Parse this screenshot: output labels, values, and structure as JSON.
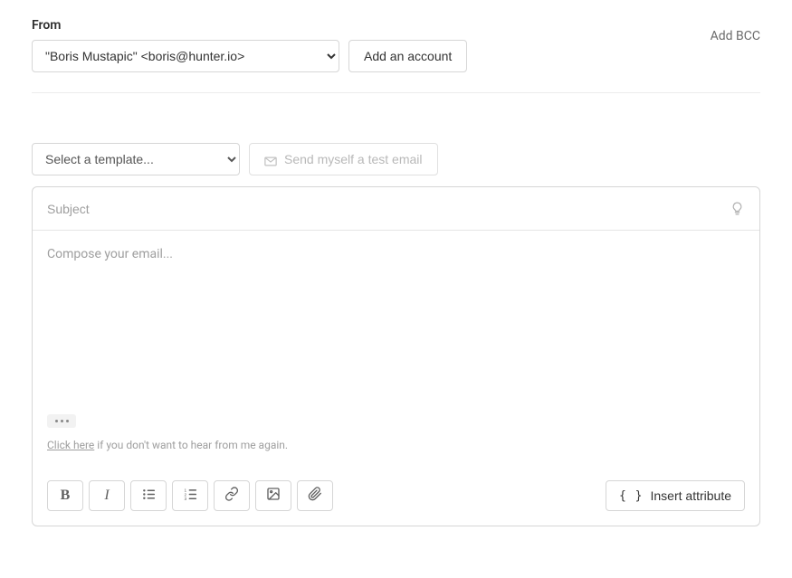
{
  "from": {
    "label": "From",
    "selected": "\"Boris Mustapic\" <boris@hunter.io>",
    "add_account_label": "Add an account",
    "add_bcc_label": "Add BCC"
  },
  "template": {
    "placeholder": "Select a template...",
    "test_email_label": "Send myself a test email"
  },
  "editor": {
    "subject_placeholder": "Subject",
    "compose_placeholder": "Compose your email...",
    "unsubscribe_link": "Click here",
    "unsubscribe_rest": " if you don't want to hear from me again."
  },
  "toolbar": {
    "bold": "B",
    "italic": "I",
    "insert_attribute_label": "Insert attribute"
  }
}
